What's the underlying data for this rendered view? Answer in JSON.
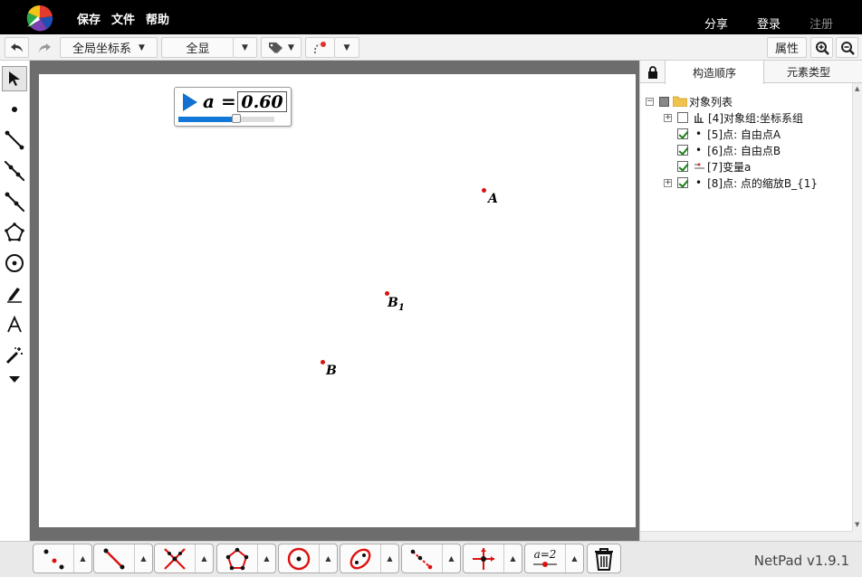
{
  "topbar": {
    "menu": [
      "保存",
      "文件",
      "帮助"
    ],
    "share": "分享",
    "login": "登录",
    "register": "注册"
  },
  "toolbar": {
    "coord_system": "全局坐标系",
    "view": "全显",
    "properties": "属性",
    "icons": [
      "undo-icon",
      "redo-icon",
      "tag-icon",
      "trace-icon",
      "zoom-in-icon",
      "zoom-out-icon"
    ]
  },
  "left_tools": [
    "select-arrow-icon",
    "point-icon",
    "segment-icon",
    "line-icon",
    "ray-icon",
    "polygon-icon",
    "circle-icon",
    "pen-icon",
    "text-icon",
    "magic-wand-icon",
    "more-icon"
  ],
  "slider": {
    "variable": "a",
    "equals": "=",
    "value": "0.60",
    "fraction": 0.6
  },
  "points": [
    {
      "label": "A"
    },
    {
      "label": "B",
      "sub": "1"
    },
    {
      "label": "B"
    }
  ],
  "panel": {
    "tabs": [
      "构造顺序",
      "元素类型"
    ],
    "tree": [
      {
        "text": "对象列表"
      },
      {
        "text": "[4]对象组:坐标系组"
      },
      {
        "text": "[5]点: 自由点A"
      },
      {
        "text": "[6]点: 自由点B"
      },
      {
        "text": "[7]变量a"
      },
      {
        "text": "[8]点: 点的缩放B_{1}"
      }
    ]
  },
  "bottom": {
    "tools": [
      "points-tool-icon",
      "segment-tool-icon",
      "intersect-tool-icon",
      "polygon-tool-icon",
      "circle-tool-icon",
      "ellipse-tool-icon",
      "path-points-tool-icon",
      "axes-tool-icon",
      "variable-tool-icon"
    ],
    "variable_tool_text": "a=2",
    "version": "NetPad v1.9.1"
  },
  "colors": {
    "accent": "#1278d8",
    "point": "#d11111",
    "topbar": "#000000"
  }
}
